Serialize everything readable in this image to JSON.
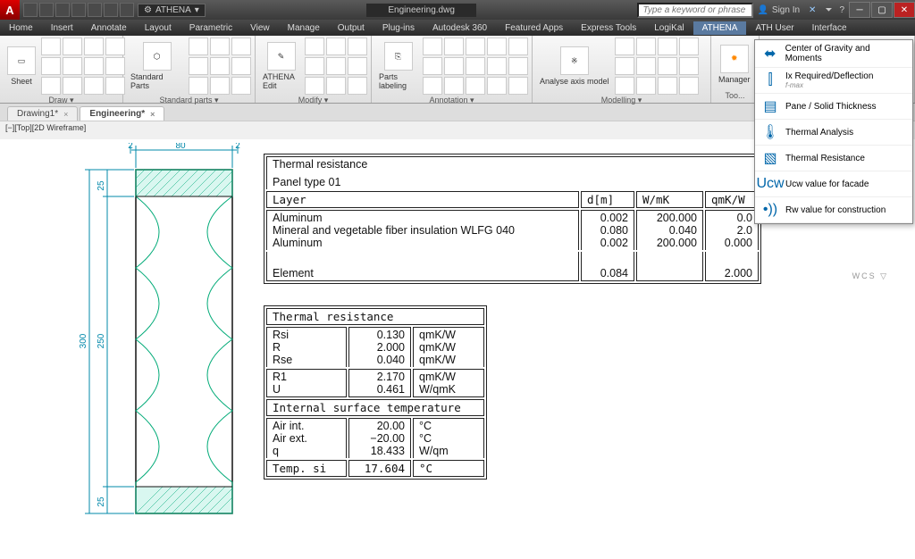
{
  "workspace": "ATHENA",
  "doc_title": "Engineering.dwg",
  "search_placeholder": "Type a keyword or phrase",
  "signin": "Sign In",
  "menus": [
    "Home",
    "Insert",
    "Annotate",
    "Layout",
    "Parametric",
    "View",
    "Manage",
    "Output",
    "Plug-ins",
    "Autodesk 360",
    "Featured Apps",
    "Express Tools",
    "LogiKal",
    "ATHENA",
    "ATH User",
    "Interface"
  ],
  "active_menu": "ATHENA",
  "ribbon": {
    "panels": [
      {
        "big": "Sheet",
        "title": "Draw ▾"
      },
      {
        "big": "Standard Parts",
        "title": "Standard parts ▾"
      },
      {
        "big": "ATHENA Edit",
        "title": "Modify ▾"
      },
      {
        "big": "Parts labeling",
        "title": "Annotation ▾"
      },
      {
        "big": "Analyse axis model",
        "title": "Modelling ▾"
      },
      {
        "big": "Manager",
        "title": "Too..."
      }
    ]
  },
  "doctabs": [
    {
      "label": "Drawing1*",
      "active": false
    },
    {
      "label": "Engineering*",
      "active": true
    }
  ],
  "viewstatus": "[−][Top][2D Wireframe]",
  "flyout": [
    {
      "icon": "⬌",
      "label": "Center of Gravity and Moments"
    },
    {
      "icon": "⫿",
      "label": "Ix Required/Deflection",
      "sub": "f-max"
    },
    {
      "icon": "▤",
      "label": "Pane / Solid Thickness"
    },
    {
      "icon": "🌡",
      "label": "Thermal Analysis"
    },
    {
      "icon": "▧",
      "label": "Thermal Resistance"
    },
    {
      "icon": "Ucw",
      "label": "Ucw value for facade"
    },
    {
      "icon": "•))",
      "label": "Rw value for construction"
    }
  ],
  "wcs": "WCS ▽",
  "dims": {
    "d80": "80",
    "d2a": "2",
    "d2b": "2",
    "d25a": "25",
    "d25b": "25",
    "d250": "250",
    "d300": "300"
  },
  "table1": {
    "title": "Thermal resistance",
    "subtitle": "Panel type 01",
    "headers": [
      "Layer",
      "d[m]",
      "W/mK",
      "qmK/W"
    ],
    "rows": [
      [
        "Aluminum",
        "0.002",
        "200.000",
        "0.0"
      ],
      [
        "Mineral and vegetable fiber insulation WLFG 040",
        "0.080",
        "0.040",
        "2.0"
      ],
      [
        "Aluminum",
        "0.002",
        "200.000",
        "0.000"
      ]
    ],
    "footer": [
      "Element",
      "0.084",
      "",
      "2.000"
    ]
  },
  "table2": {
    "section1_title": "Thermal resistance",
    "r_rows": [
      [
        "Rsi",
        "0.130",
        "qmK/W"
      ],
      [
        "R",
        "2.000",
        "qmK/W"
      ],
      [
        "Rse",
        "0.040",
        "qmK/W"
      ]
    ],
    "r2_rows": [
      [
        "R1",
        "2.170",
        "qmK/W"
      ],
      [
        "U",
        "0.461",
        "W/qmK"
      ]
    ],
    "section2_title": "Internal surface temperature",
    "t_rows": [
      [
        "Air int.",
        "20.00",
        "°C"
      ],
      [
        "Air ext.",
        "−20.00",
        "°C"
      ],
      [
        "q",
        "18.433",
        "W/qm"
      ]
    ],
    "t_footer": [
      "Temp. si",
      "17.604",
      "°C"
    ]
  }
}
